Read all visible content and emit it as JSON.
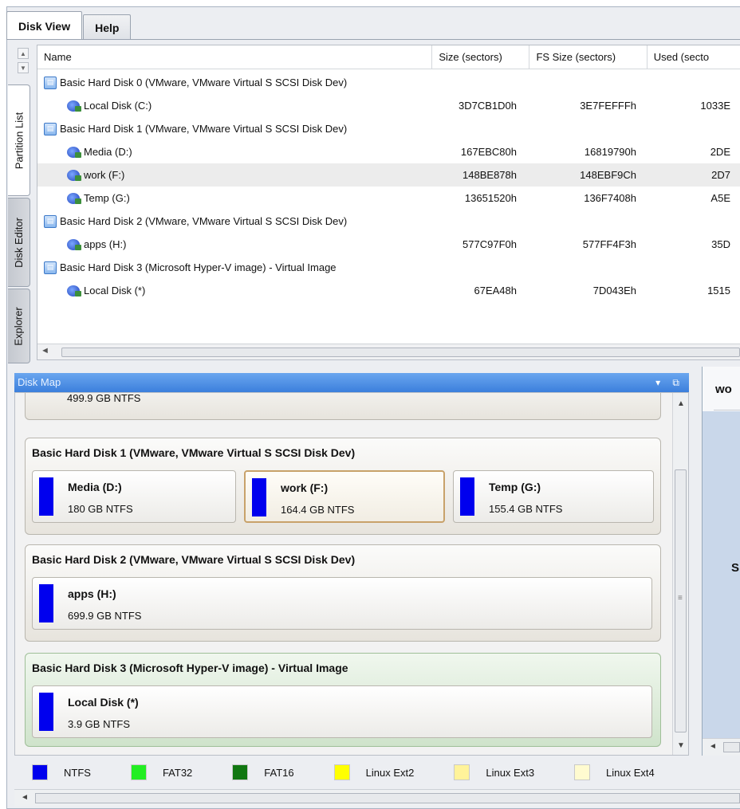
{
  "tabs": [
    {
      "label": "Disk View",
      "active": true
    },
    {
      "label": "Help",
      "active": false
    }
  ],
  "side_tabs": [
    "Partition List",
    "Disk Editor",
    "Explorer"
  ],
  "partition_list": {
    "columns": [
      "Name",
      "Size (sectors)",
      "FS Size (sectors)",
      "Used (secto"
    ],
    "rows": [
      {
        "kind": "disk",
        "name": "Basic Hard Disk 0 (VMware, VMware Virtual S SCSI Disk Dev)",
        "size": "",
        "fs_size": "",
        "used": ""
      },
      {
        "kind": "volume",
        "name": "Local Disk (C:)",
        "size": "3D7CB1D0h",
        "fs_size": "3E7FEFFFh",
        "used": "1033E"
      },
      {
        "kind": "disk",
        "name": "Basic Hard Disk 1 (VMware, VMware Virtual S SCSI Disk Dev)",
        "size": "",
        "fs_size": "",
        "used": ""
      },
      {
        "kind": "volume",
        "name": "Media (D:)",
        "size": "167EBC80h",
        "fs_size": "16819790h",
        "used": "2DE"
      },
      {
        "kind": "volume",
        "name": "work (F:)",
        "size": "148BE878h",
        "fs_size": "148EBF9Ch",
        "used": "2D7",
        "selected": true
      },
      {
        "kind": "volume",
        "name": "Temp (G:)",
        "size": "13651520h",
        "fs_size": "136F7408h",
        "used": "A5E"
      },
      {
        "kind": "disk",
        "name": "Basic Hard Disk 2 (VMware, VMware Virtual S SCSI Disk Dev)",
        "size": "",
        "fs_size": "",
        "used": ""
      },
      {
        "kind": "volume",
        "name": "apps (H:)",
        "size": "577C97F0h",
        "fs_size": "577FF4F3h",
        "used": "35D"
      },
      {
        "kind": "disk",
        "name": "Basic Hard Disk 3 (Microsoft Hyper-V image) - Virtual Image",
        "size": "",
        "fs_size": "",
        "used": ""
      },
      {
        "kind": "volume",
        "name": "Local Disk (*)",
        "size": "67EA48h",
        "fs_size": "7D043Eh",
        "used": "1515"
      }
    ]
  },
  "disk_map": {
    "title": "Disk Map",
    "partial_top_fs": "499.9 GB NTFS",
    "disks": [
      {
        "title": "Basic Hard Disk 1 (VMware, VMware Virtual S SCSI Disk Dev)",
        "partitions": [
          {
            "name": "Media (D:)",
            "fs": "180 GB NTFS"
          },
          {
            "name": "work (F:)",
            "fs": "164.4 GB NTFS",
            "selected": true
          },
          {
            "name": "Temp (G:)",
            "fs": "155.4 GB NTFS"
          }
        ]
      },
      {
        "title": "Basic Hard Disk 2 (VMware, VMware Virtual S SCSI Disk Dev)",
        "partitions": [
          {
            "name": "apps (H:)",
            "fs": "699.9 GB NTFS"
          }
        ]
      },
      {
        "title": "Basic Hard Disk 3 (Microsoft Hyper-V image) - Virtual Image",
        "highlighted": true,
        "partitions": [
          {
            "name": "Local Disk (*)",
            "fs": "3.9 GB NTFS"
          }
        ]
      }
    ]
  },
  "properties": {
    "title_partial": "wo",
    "letter_partial": "S"
  },
  "legend": [
    {
      "label": "NTFS",
      "color": "#0000ee"
    },
    {
      "label": "FAT32",
      "color": "#22ee22"
    },
    {
      "label": "FAT16",
      "color": "#117711"
    },
    {
      "label": "Linux Ext2",
      "color": "#ffff00"
    },
    {
      "label": "Linux Ext3",
      "color": "#fff39a"
    },
    {
      "label": "Linux Ext4",
      "color": "#fffbd0"
    }
  ]
}
